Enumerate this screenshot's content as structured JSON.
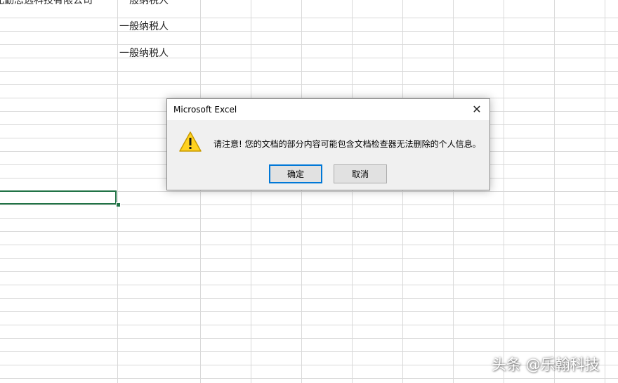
{
  "sheet": {
    "cells": [
      {
        "text": "湖北勤思远科技有限公司"
      },
      {
        "text": "一般纳税人"
      },
      {
        "text": "一般纳税人"
      },
      {
        "text": "一般纳税人"
      }
    ]
  },
  "dialog": {
    "title": "Microsoft Excel",
    "close_symbol": "✕",
    "icon": "warning-icon",
    "message": "请注意! 您的文档的部分内容可能包含文档检查器无法删除的个人信息。",
    "ok_label": "确定",
    "cancel_label": "取消"
  },
  "watermark": "头条 @乐翰科技",
  "colors": {
    "selection": "#217346",
    "default_button_border": "#0078d7",
    "warning": "#ffd700"
  }
}
